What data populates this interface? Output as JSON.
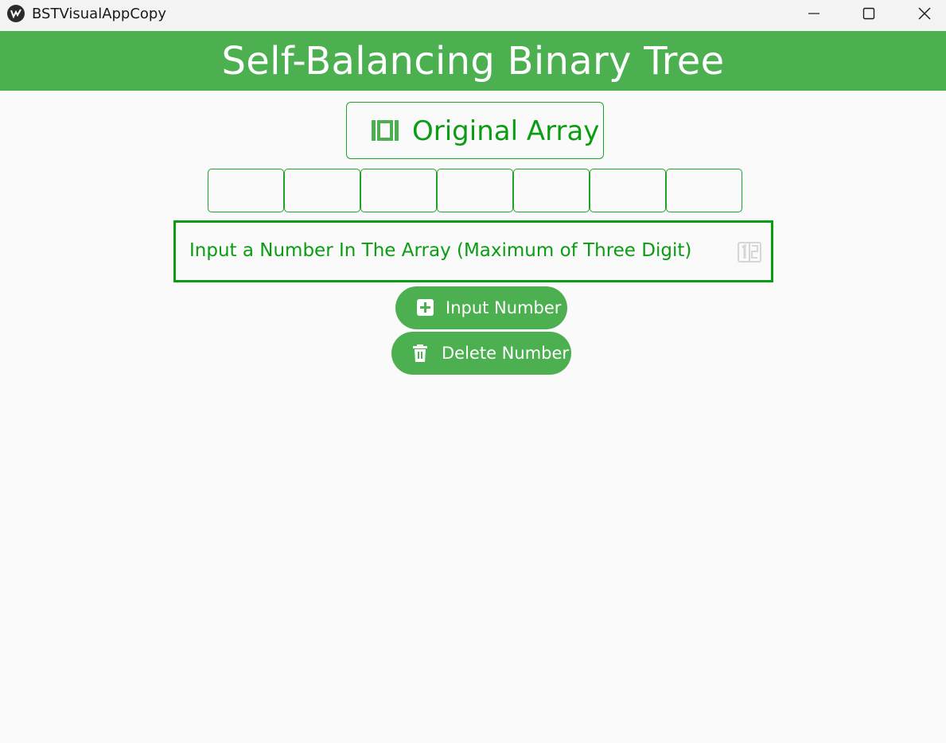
{
  "window": {
    "title": "BSTVisualAppCopy",
    "icon": "kivy-app-icon",
    "controls": [
      "minimize-icon",
      "maximize-icon",
      "close-icon"
    ]
  },
  "header": {
    "title": "Self-Balancing Binary Tree",
    "background": "#4caf50"
  },
  "original_array": {
    "label": "Original Array",
    "icon": "array-brackets-icon"
  },
  "array": {
    "cells": [
      "",
      "",
      "",
      "",
      "",
      "",
      ""
    ]
  },
  "number_input": {
    "placeholder": "Input a Number In The Array (Maximum of Three Digit)",
    "value": "",
    "icon": "numeric-icon"
  },
  "buttons": {
    "input_number": {
      "label": "Input Number",
      "icon": "plus-box-icon"
    },
    "delete_number": {
      "label": "Delete Number",
      "icon": "trash-icon"
    }
  },
  "colors": {
    "accent": "#4caf50",
    "text_green": "#0a9c12",
    "background": "#fafafa"
  }
}
